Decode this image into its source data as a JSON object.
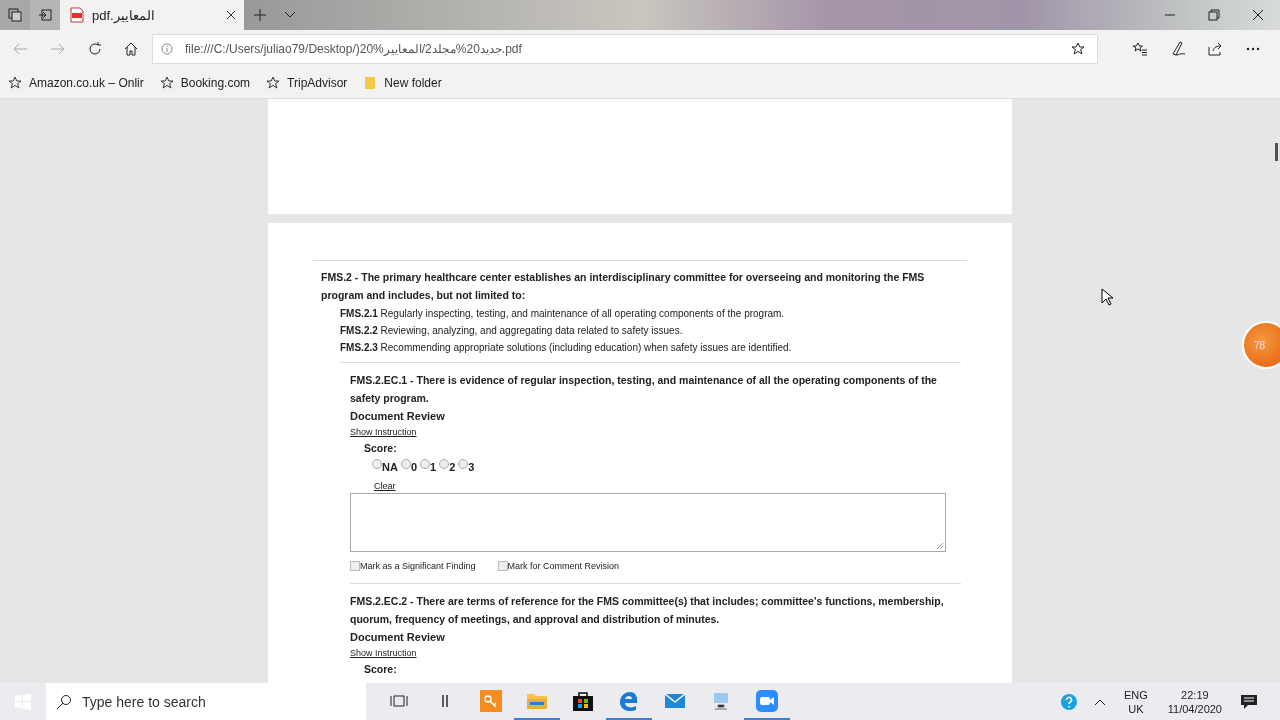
{
  "browser": {
    "tabs": [
      {
        "title": "pdf.المعايير",
        "selected": true
      }
    ],
    "address": "file:///C:/Users/juliao79/Desktop/)20%جديد20%مجلد2/المعايير.pdf",
    "bookmarks": [
      {
        "kind": "star",
        "label": "Amazon.co.uk – Onlir"
      },
      {
        "kind": "star",
        "label": "Booking.com"
      },
      {
        "kind": "star",
        "label": "TripAdvisor"
      },
      {
        "kind": "folder",
        "label": "New folder"
      }
    ]
  },
  "document": {
    "standard": "FMS.2 - The primary healthcare center establishes an interdisciplinary committee for overseeing and monitoring the FMS program and includes, but not limited to:",
    "sub_items": [
      "**FMS.2.1** Regularly inspecting, testing, and maintenance of all operating components of the program.",
      "**FMS.2.2** Reviewing, analyzing, and aggregating data related to safety issues.",
      "**FMS.2.3** Recommending appropriate solutions (including education) when safety issues are identified."
    ],
    "elements": [
      {
        "title": "FMS.2.EC.1 - There is evidence of regular inspection, testing, and maintenance of all the operating components of the safety program.",
        "method": "Document Review",
        "instruction_link": "Show Instruction",
        "score_label": "Score:",
        "options": [
          {
            "label": "NA",
            "selected": false
          },
          {
            "label": "0",
            "selected": false
          },
          {
            "label": "1",
            "selected": false
          },
          {
            "label": "2",
            "selected": false
          },
          {
            "label": "3",
            "selected": false
          }
        ],
        "clear": "Clear",
        "checkboxes": [
          {
            "label": "Mark as a Significant Finding",
            "checked": false
          },
          {
            "label": "Mark for Comment Revision",
            "checked": false
          }
        ]
      },
      {
        "title": "FMS.2.EC.2 - There are terms of reference for the FMS committee(s) that includes; committee’s functions, membership, quorum, frequency of meetings, and approval and distribution of minutes.",
        "method": "Document Review",
        "instruction_link": "Show Instruction",
        "score_label": "Score:"
      }
    ]
  },
  "floating_badge": "78",
  "taskbar": {
    "search_placeholder": "Type here to search",
    "apps": [
      {
        "kind": "taskview",
        "running": false
      },
      {
        "kind": "bars",
        "running": false
      },
      {
        "kind": "key",
        "running": false
      },
      {
        "kind": "folder",
        "running": true
      },
      {
        "kind": "store",
        "running": false
      },
      {
        "kind": "edge",
        "running": true
      },
      {
        "kind": "mail",
        "running": false
      },
      {
        "kind": "network",
        "running": false
      },
      {
        "kind": "camera",
        "running": true
      }
    ],
    "language": "ENG",
    "region": "UK",
    "time": "22:19",
    "date": "11/04/2020"
  }
}
